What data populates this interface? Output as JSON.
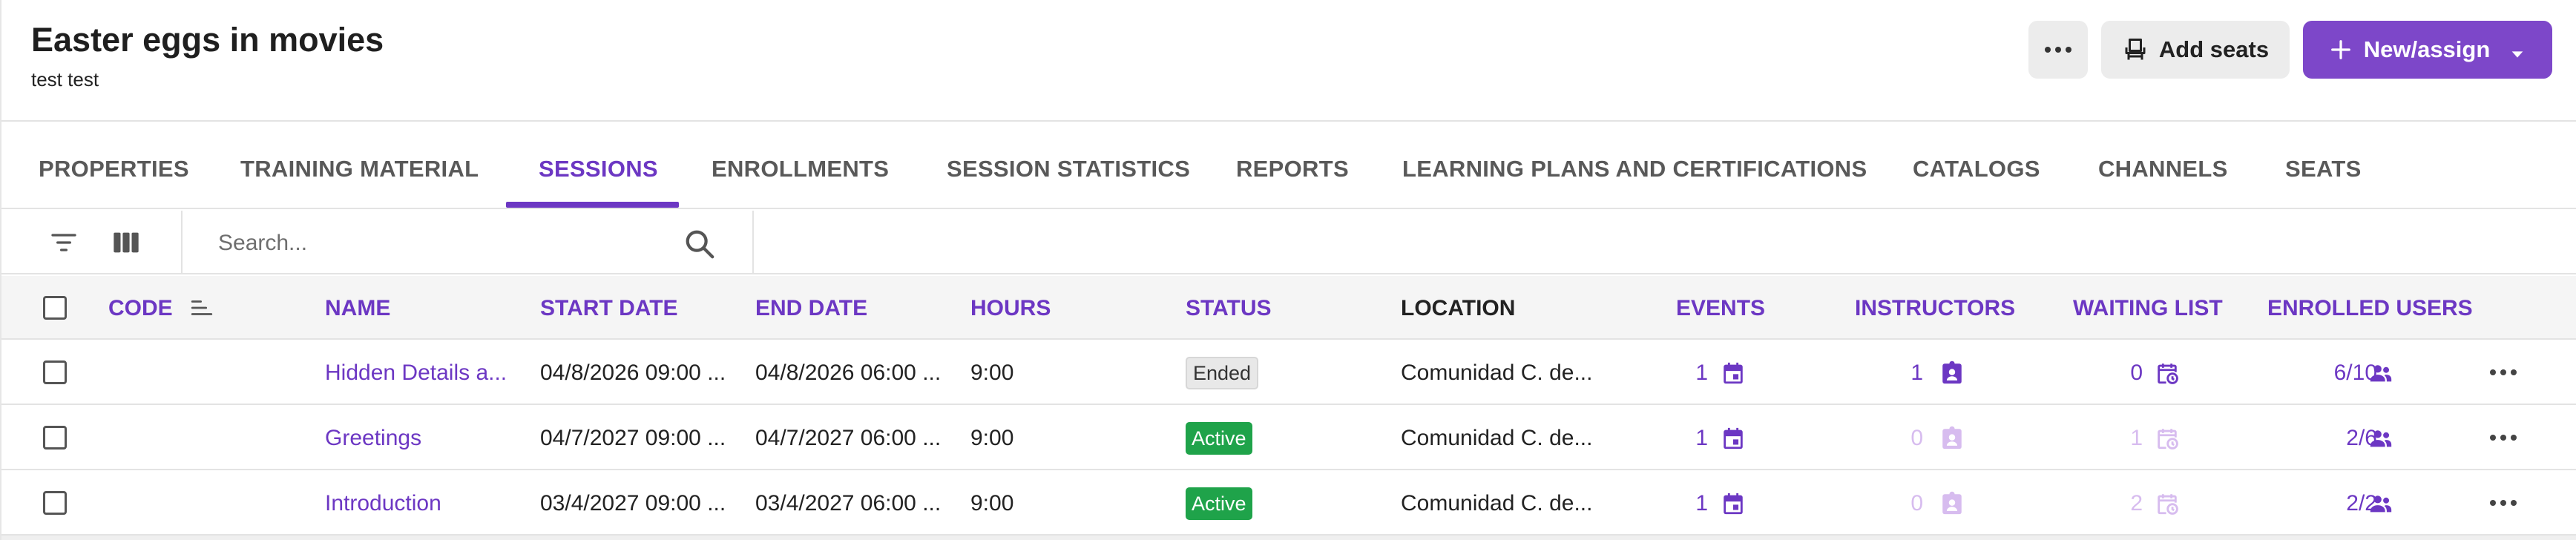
{
  "header": {
    "title": "Easter eggs in movies",
    "subtitle": "test test",
    "add_seats_label": "Add seats",
    "new_assign_label": "New/assign",
    "accent": "#7d47c9"
  },
  "tabs": [
    {
      "label": "PROPERTIES"
    },
    {
      "label": "TRAINING MATERIAL"
    },
    {
      "label": "SESSIONS",
      "active": true
    },
    {
      "label": "ENROLLMENTS"
    },
    {
      "label": "SESSION STATISTICS"
    },
    {
      "label": "REPORTS"
    },
    {
      "label": "LEARNING PLANS AND CERTIFICATIONS"
    },
    {
      "label": "CATALOGS"
    },
    {
      "label": "CHANNELS"
    },
    {
      "label": "SEATS"
    }
  ],
  "toolbar": {
    "search_placeholder": "Search..."
  },
  "table": {
    "columns": {
      "code": "CODE",
      "name": "NAME",
      "start_date": "START DATE",
      "end_date": "END DATE",
      "hours": "HOURS",
      "status": "STATUS",
      "location": "LOCATION",
      "events": "EVENTS",
      "instructors": "INSTRUCTORS",
      "waiting_list": "WAITING LIST",
      "enrolled_users": "ENROLLED USERS"
    },
    "rows": [
      {
        "code": "",
        "name": "Hidden Details a...",
        "start_date": "04/8/2026 09:00 ...",
        "end_date": "04/8/2026 06:00 ...",
        "hours": "9:00",
        "status": "Ended",
        "location": "Comunidad C. de...",
        "events": "1",
        "instructors": "1",
        "waiting_list": "0",
        "enrolled_users": "6/10"
      },
      {
        "code": "",
        "name": "Greetings",
        "start_date": "04/7/2027 09:00 ...",
        "end_date": "04/7/2027 06:00 ...",
        "hours": "9:00",
        "status": "Active",
        "location": "Comunidad C. de...",
        "events": "1",
        "instructors": "0",
        "waiting_list": "1",
        "enrolled_users": "2/6"
      },
      {
        "code": "",
        "name": "Introduction",
        "start_date": "03/4/2027 09:00 ...",
        "end_date": "03/4/2027 06:00 ...",
        "hours": "9:00",
        "status": "Active",
        "location": "Comunidad C. de...",
        "events": "1",
        "instructors": "0",
        "waiting_list": "2",
        "enrolled_users": "2/2"
      }
    ]
  },
  "colors": {
    "accent": "#6c37c3",
    "muted_accent": "#d7bcef",
    "active_status": "#1fa34a",
    "ended_status": "#e8e8e8"
  }
}
